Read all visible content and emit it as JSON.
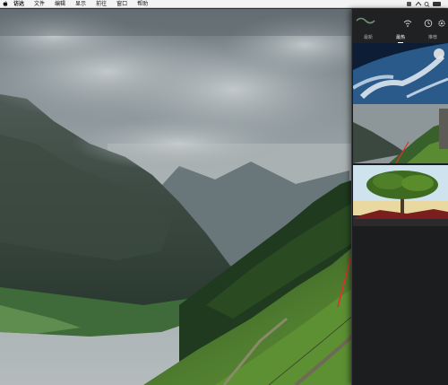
{
  "menubar": {
    "items": [
      "访达",
      "文件",
      "编辑",
      "显示",
      "前往",
      "窗口",
      "帮助"
    ]
  },
  "panel": {
    "tabs": [
      {
        "label": "最新"
      },
      {
        "label": "最热"
      },
      {
        "label": "推荐"
      }
    ],
    "active_tab": "最热"
  },
  "colors": {
    "menubar_bg": "#f3f3f3",
    "panel_bg": "#1c1d1f",
    "arrow": "#e0322a"
  },
  "icons": [
    "apple-icon",
    "wifi-icon",
    "search-icon",
    "clock-icon",
    "settings-icon"
  ]
}
